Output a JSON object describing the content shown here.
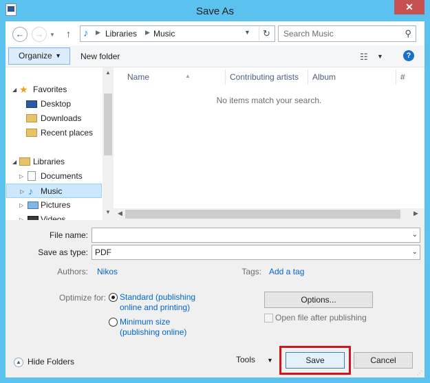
{
  "window": {
    "title": "Save As",
    "close": "✕"
  },
  "nav": {
    "back_glyph": "←",
    "forward_glyph": "→",
    "up_glyph": "↑",
    "breadcrumb": [
      "Libraries",
      "Music"
    ],
    "refresh_glyph": "↻",
    "search_placeholder": "Search Music"
  },
  "toolbar": {
    "organize_label": "Organize",
    "new_folder_label": "New folder",
    "help_glyph": "?"
  },
  "sidebar": {
    "groups": [
      {
        "label": "Favorites",
        "items": [
          "Desktop",
          "Downloads",
          "Recent places"
        ]
      },
      {
        "label": "Libraries",
        "items": [
          "Documents",
          "Music",
          "Pictures",
          "Videos"
        ]
      }
    ],
    "selected": "Music"
  },
  "content": {
    "columns": [
      "Name",
      "Contributing artists",
      "Album",
      "#"
    ],
    "empty_message": "No items match your search."
  },
  "form": {
    "file_name_label": "File name:",
    "file_name_value": "",
    "save_type_label": "Save as type:",
    "save_type_value": "PDF",
    "authors_label": "Authors:",
    "authors_value": "Nikos",
    "tags_label": "Tags:",
    "tags_value": "Add a tag",
    "optimize_label": "Optimize for:",
    "optimize_options": [
      {
        "line1": "Standard (publishing",
        "line2": "online and printing)",
        "selected": true
      },
      {
        "line1": "Minimum size",
        "line2": "(publishing online)",
        "selected": false
      }
    ],
    "options_button": "Options...",
    "open_after_label": "Open file after publishing",
    "open_after_checked": false
  },
  "footer": {
    "hide_folders_label": "Hide Folders",
    "tools_label": "Tools",
    "save_label": "Save",
    "cancel_label": "Cancel"
  },
  "colors": {
    "title_bar": "#5bc2f0",
    "close_button": "#c75050",
    "link": "#0066cc",
    "selection": "#cce8ff",
    "highlight": "#d4141c"
  }
}
